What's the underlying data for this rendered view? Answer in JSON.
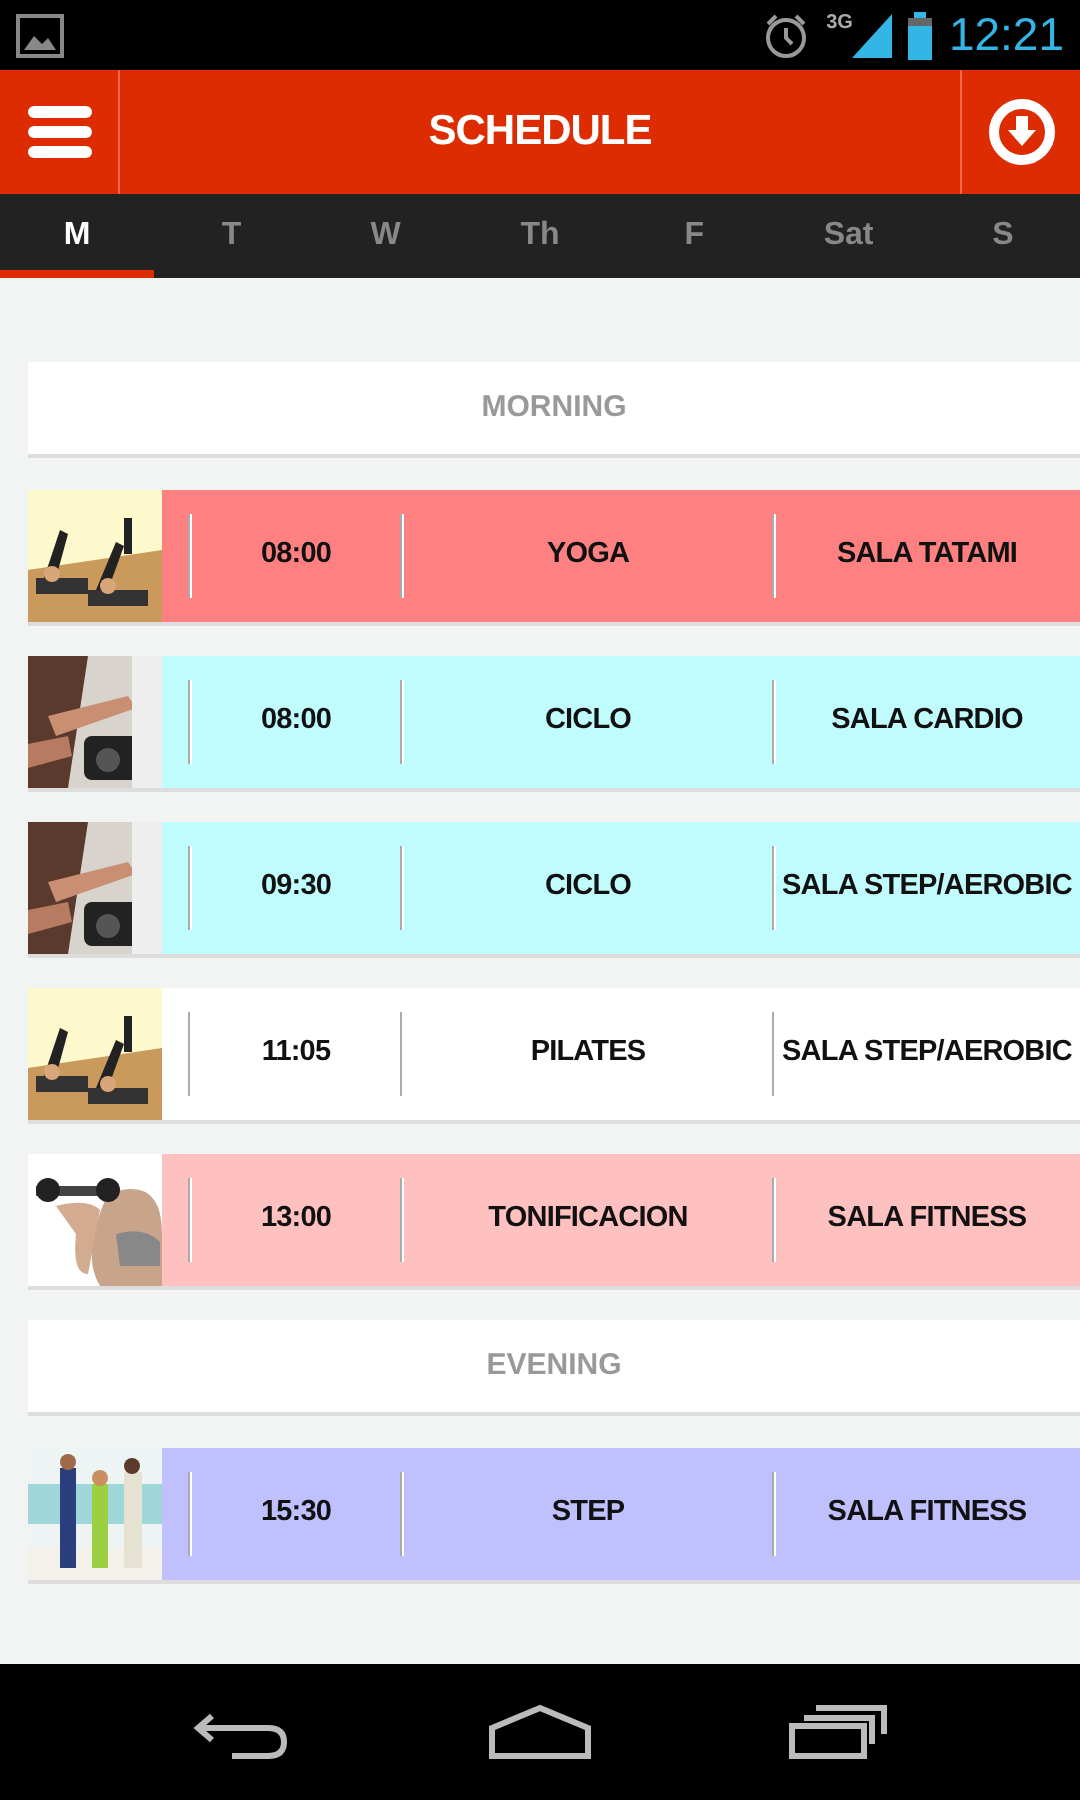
{
  "status_bar": {
    "network": "3G",
    "time": "12:21"
  },
  "header": {
    "title": "SCHEDULE"
  },
  "days": [
    {
      "label": "M",
      "selected": true
    },
    {
      "label": "T",
      "selected": false
    },
    {
      "label": "W",
      "selected": false
    },
    {
      "label": "Th",
      "selected": false
    },
    {
      "label": "F",
      "selected": false
    },
    {
      "label": "Sat",
      "selected": false
    },
    {
      "label": "S",
      "selected": false
    }
  ],
  "sections": [
    {
      "title": "MORNING",
      "classes": [
        {
          "time": "08:00",
          "name": "YOGA",
          "room": "SALA TATAMI",
          "color": "#ff8080"
        },
        {
          "time": "08:00",
          "name": "CICLO",
          "room": "SALA CARDIO",
          "color": "#c0fcfe"
        },
        {
          "time": "09:30",
          "name": "CICLO",
          "room": "SALA STEP/AEROBIC",
          "color": "#c0fcfe"
        },
        {
          "time": "11:05",
          "name": "PILATES",
          "room": "SALA STEP/AEROBIC",
          "color": "#ffffff"
        },
        {
          "time": "13:00",
          "name": "TONIFICACION",
          "room": "SALA FITNESS",
          "color": "#ffc0c0"
        }
      ]
    },
    {
      "title": "EVENING",
      "classes": [
        {
          "time": "15:30",
          "name": "STEP",
          "room": "SALA FITNESS",
          "color": "#c0c0ff"
        }
      ]
    }
  ]
}
